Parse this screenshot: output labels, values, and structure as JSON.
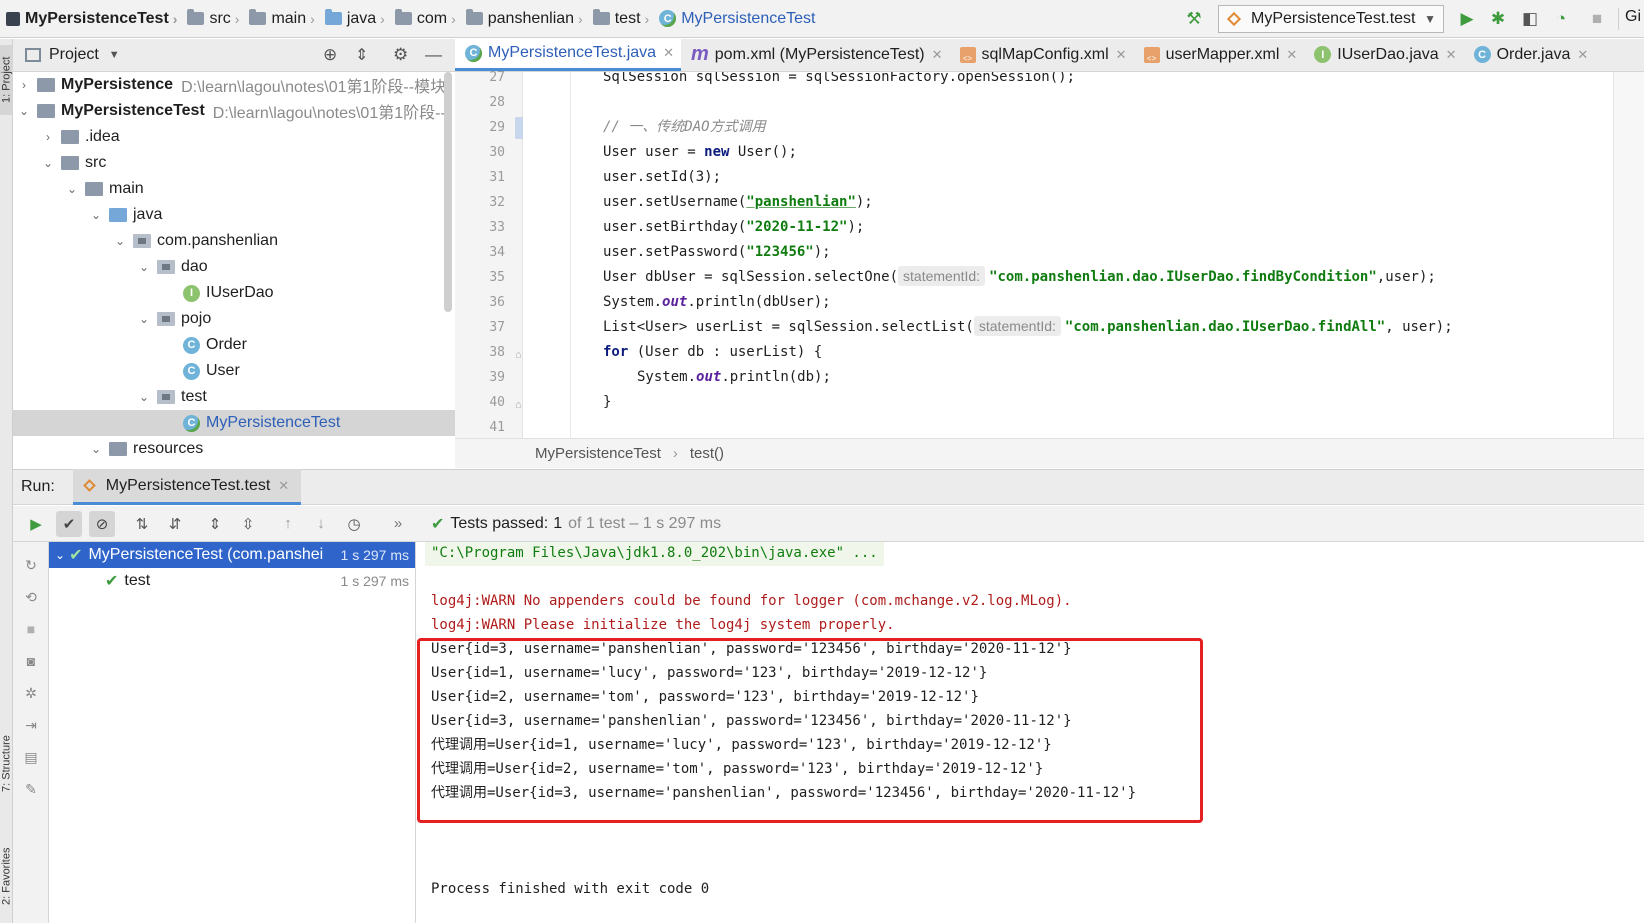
{
  "navbar": {
    "crumbs": [
      "MyPersistenceTest",
      "src",
      "main",
      "java",
      "com",
      "panshenlian",
      "test",
      "MyPersistenceTest"
    ],
    "run_config": "MyPersistenceTest.test",
    "cut_label": "Gi"
  },
  "left_strip": {
    "project_label": "1: Project",
    "structure_label": "7: Structure",
    "favorites_label": "2: Favorites"
  },
  "project_panel": {
    "title": "Project",
    "tree": [
      {
        "label": "MyPersistence",
        "path": "D:\\learn\\lagou\\notes\\01第1阶段--模块"
      },
      {
        "label": "MyPersistenceTest",
        "path": "D:\\learn\\lagou\\notes\\01第1阶段--"
      },
      {
        "label": ".idea"
      },
      {
        "label": "src"
      },
      {
        "label": "main"
      },
      {
        "label": "java"
      },
      {
        "label": "com.panshenlian"
      },
      {
        "label": "dao"
      },
      {
        "label": "IUserDao"
      },
      {
        "label": "pojo"
      },
      {
        "label": "Order"
      },
      {
        "label": "User"
      },
      {
        "label": "test"
      },
      {
        "label": "MyPersistenceTest"
      },
      {
        "label": "resources"
      }
    ]
  },
  "editor": {
    "tabs": [
      {
        "label": "MyPersistenceTest.java"
      },
      {
        "label": "pom.xml (MyPersistenceTest)"
      },
      {
        "label": "sqlMapConfig.xml"
      },
      {
        "label": "userMapper.xml"
      },
      {
        "label": "IUserDao.java"
      },
      {
        "label": "Order.java"
      }
    ],
    "line_numbers": [
      "27",
      "28",
      "29",
      "30",
      "31",
      "32",
      "33",
      "34",
      "35",
      "36",
      "37",
      "38",
      "39",
      "40",
      "41"
    ],
    "code": {
      "l27": "SqlSession sqlSession = sqlSessionFactory.openSession();",
      "l29": "// 一、传统DAO方式调用",
      "l30_a": "User user = ",
      "l30_kw": "new",
      "l30_b": " User();",
      "l31": "user.setId(3);",
      "l32_a": "user.setUsername(",
      "l32_s": "\"panshenlian\"",
      "l32_b": ");",
      "l33_a": "user.setBirthday(",
      "l33_s": "\"2020-11-12\"",
      "l33_b": ");",
      "l34_a": "user.setPassword(",
      "l34_s": "\"123456\"",
      "l34_b": ");",
      "l35_a": "User dbUser = sqlSession.selectOne(",
      "l35_hint": "statementId:",
      "l35_s": "\"com.panshenlian.dao.IUserDao.findByCondition\"",
      "l35_b": ",user);",
      "l36_a": "System.",
      "l36_it": "out",
      "l36_b": ".println(dbUser);",
      "l37_a": "List<User> userList = sqlSession.selectList(",
      "l37_hint": "statementId:",
      "l37_s": "\"com.panshenlian.dao.IUserDao.findAll\"",
      "l37_b": ", user);",
      "l38_kw": "for",
      "l38_b": " (User db : userList) {",
      "l39_a": "System.",
      "l39_it": "out",
      "l39_b": ".println(db);",
      "l40": "}"
    },
    "breadcrumb": [
      "MyPersistenceTest",
      "test()"
    ]
  },
  "run_panel": {
    "label": "Run:",
    "tab": "MyPersistenceTest.test",
    "tests_passed_label": "Tests passed:",
    "tests_passed_count": "1",
    "tests_meta": "of 1 test – 1 s 297 ms",
    "test_tree": [
      {
        "label": "MyPersistenceTest (com.panshei",
        "duration": "1 s 297 ms"
      },
      {
        "label": "test",
        "duration": "1 s 297 ms"
      }
    ],
    "console": [
      "\"C:\\Program Files\\Java\\jdk1.8.0_202\\bin\\java.exe\" ...",
      "log4j:WARN No appenders could be found for logger (com.mchange.v2.log.MLog).",
      "log4j:WARN Please initialize the log4j system properly.",
      "User{id=3, username='panshenlian', password='123456', birthday='2020-11-12'}",
      "User{id=1, username='lucy', password='123', birthday='2019-12-12'}",
      "User{id=2, username='tom', password='123', birthday='2019-12-12'}",
      "User{id=3, username='panshenlian', password='123456', birthday='2020-11-12'}",
      "代理调用=User{id=1, username='lucy', password='123', birthday='2019-12-12'}",
      "代理调用=User{id=2, username='tom', password='123', birthday='2019-12-12'}",
      "代理调用=User{id=3, username='panshenlian', password='123456', birthday='2020-11-12'}",
      "Process finished with exit code 0"
    ]
  },
  "colors": {
    "accent": "#4a8bd6",
    "selection": "#2f65ca",
    "pass_green": "#3e9b3e",
    "warn_red": "#b01c1c",
    "highlight_box": "#e52020"
  }
}
